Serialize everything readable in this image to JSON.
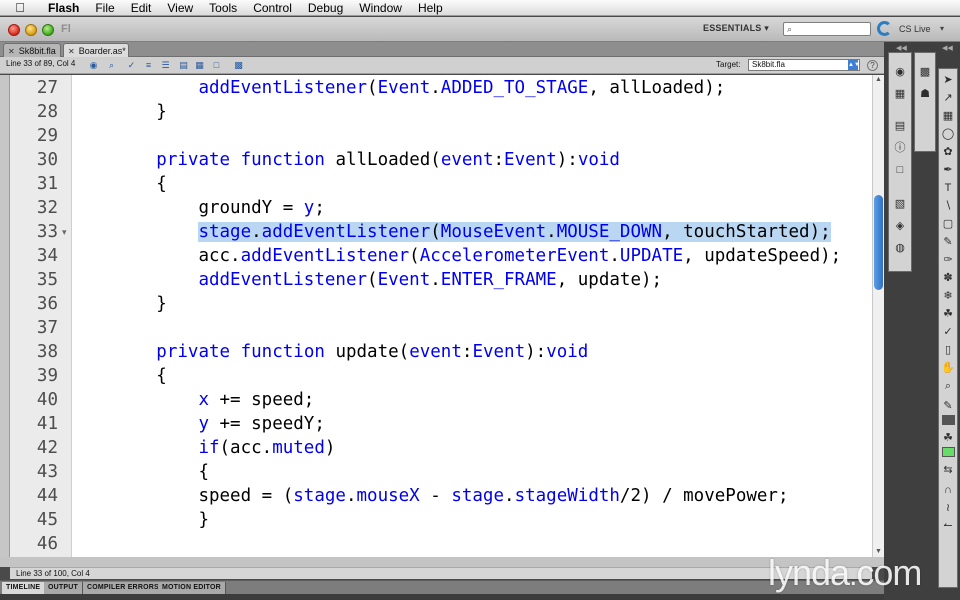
{
  "menubar": {
    "app_name": "Flash",
    "menus": [
      "File",
      "Edit",
      "View",
      "Tools",
      "Control",
      "Debug",
      "Window",
      "Help"
    ]
  },
  "appbar": {
    "workspace": "ESSENTIALS ▾",
    "search_placeholder": "⌕",
    "cs_live": "CS Live",
    "cs_live_caret": "▾"
  },
  "tabs": [
    {
      "label": "Sk8bit.fla",
      "active": false
    },
    {
      "label": "Boarder.as*",
      "active": true
    }
  ],
  "script_toolbar": {
    "line_info": "Line 33 of 89, Col 4",
    "target_label": "Target:",
    "target_value": "Sk8bit.fla"
  },
  "editor": {
    "fold_marker": "▾",
    "lines": [
      {
        "num": "27",
        "indent": "            ",
        "tokens": [
          {
            "t": "addEventListener",
            "k": "kw"
          },
          {
            "t": "(",
            "k": ""
          },
          {
            "t": "Event",
            "k": "kw"
          },
          {
            "t": ".",
            "k": ""
          },
          {
            "t": "ADDED_TO_STAGE",
            "k": "kw"
          },
          {
            "t": ", allLoaded);",
            "k": ""
          }
        ]
      },
      {
        "num": "28",
        "indent": "        ",
        "tokens": [
          {
            "t": "}",
            "k": ""
          }
        ]
      },
      {
        "num": "29",
        "indent": "",
        "tokens": []
      },
      {
        "num": "30",
        "indent": "        ",
        "tokens": [
          {
            "t": "private",
            "k": "kw"
          },
          {
            "t": " ",
            "k": ""
          },
          {
            "t": "function",
            "k": "kw"
          },
          {
            "t": " allLoaded(",
            "k": ""
          },
          {
            "t": "event",
            "k": "kw"
          },
          {
            "t": ":",
            "k": ""
          },
          {
            "t": "Event",
            "k": "kw"
          },
          {
            "t": "):",
            "k": ""
          },
          {
            "t": "void",
            "k": "kw"
          }
        ]
      },
      {
        "num": "31",
        "indent": "        ",
        "tokens": [
          {
            "t": "{",
            "k": ""
          }
        ]
      },
      {
        "num": "32",
        "indent": "            ",
        "tokens": [
          {
            "t": "groundY = ",
            "k": ""
          },
          {
            "t": "y",
            "k": "kw"
          },
          {
            "t": ";",
            "k": ""
          }
        ]
      },
      {
        "num": "33",
        "indent": "            ",
        "highlight": true,
        "tokens": [
          {
            "t": "stage",
            "k": "kw"
          },
          {
            "t": ".",
            "k": ""
          },
          {
            "t": "addEventListener",
            "k": "kw"
          },
          {
            "t": "(",
            "k": ""
          },
          {
            "t": "MouseEvent",
            "k": "kw"
          },
          {
            "t": ".",
            "k": ""
          },
          {
            "t": "MOUSE_DOWN",
            "k": "kw"
          },
          {
            "t": ", touchStarted);",
            "k": ""
          }
        ]
      },
      {
        "num": "34",
        "indent": "            ",
        "tokens": [
          {
            "t": "acc.",
            "k": ""
          },
          {
            "t": "addEventListener",
            "k": "kw"
          },
          {
            "t": "(",
            "k": ""
          },
          {
            "t": "AccelerometerEvent",
            "k": "kw"
          },
          {
            "t": ".",
            "k": ""
          },
          {
            "t": "UPDATE",
            "k": "kw"
          },
          {
            "t": ", updateSpeed);",
            "k": ""
          }
        ]
      },
      {
        "num": "35",
        "indent": "            ",
        "tokens": [
          {
            "t": "addEventListener",
            "k": "kw"
          },
          {
            "t": "(",
            "k": ""
          },
          {
            "t": "Event",
            "k": "kw"
          },
          {
            "t": ".",
            "k": ""
          },
          {
            "t": "ENTER_FRAME",
            "k": "kw"
          },
          {
            "t": ", update);",
            "k": ""
          }
        ]
      },
      {
        "num": "36",
        "indent": "        ",
        "tokens": [
          {
            "t": "}",
            "k": ""
          }
        ]
      },
      {
        "num": "37",
        "indent": "",
        "tokens": []
      },
      {
        "num": "38",
        "indent": "        ",
        "tokens": [
          {
            "t": "private",
            "k": "kw"
          },
          {
            "t": " ",
            "k": ""
          },
          {
            "t": "function",
            "k": "kw"
          },
          {
            "t": " update(",
            "k": ""
          },
          {
            "t": "event",
            "k": "kw"
          },
          {
            "t": ":",
            "k": ""
          },
          {
            "t": "Event",
            "k": "kw"
          },
          {
            "t": "):",
            "k": ""
          },
          {
            "t": "void",
            "k": "kw"
          }
        ]
      },
      {
        "num": "39",
        "indent": "        ",
        "tokens": [
          {
            "t": "{",
            "k": ""
          }
        ]
      },
      {
        "num": "40",
        "indent": "            ",
        "tokens": [
          {
            "t": "x",
            "k": "kw"
          },
          {
            "t": " += speed;",
            "k": ""
          }
        ]
      },
      {
        "num": "41",
        "indent": "            ",
        "tokens": [
          {
            "t": "y",
            "k": "kw"
          },
          {
            "t": " += speedY;",
            "k": ""
          }
        ]
      },
      {
        "num": "42",
        "indent": "            ",
        "tokens": [
          {
            "t": "if",
            "k": "kw"
          },
          {
            "t": "(acc.",
            "k": ""
          },
          {
            "t": "muted",
            "k": "kw"
          },
          {
            "t": ")",
            "k": ""
          }
        ]
      },
      {
        "num": "43",
        "indent": "            ",
        "tokens": [
          {
            "t": "{",
            "k": ""
          }
        ]
      },
      {
        "num": "44",
        "indent": "            ",
        "tokens": [
          {
            "t": "speed = (",
            "k": ""
          },
          {
            "t": "stage",
            "k": "kw"
          },
          {
            "t": ".",
            "k": ""
          },
          {
            "t": "mouseX",
            "k": "kw"
          },
          {
            "t": " - ",
            "k": ""
          },
          {
            "t": "stage",
            "k": "kw"
          },
          {
            "t": ".",
            "k": ""
          },
          {
            "t": "stageWidth",
            "k": "kw"
          },
          {
            "t": "/2) / movePower;",
            "k": ""
          }
        ]
      },
      {
        "num": "45",
        "indent": "            ",
        "tokens": [
          {
            "t": "}",
            "k": ""
          }
        ]
      },
      {
        "num": "46",
        "indent": "",
        "tokens": []
      }
    ]
  },
  "status": {
    "line_info": "Line 33 of 100, Col 4"
  },
  "panel_tabs": [
    "TIMELINE",
    "OUTPUT",
    "COMPILER ERRORS",
    "MOTION EDITOR"
  ],
  "colors": {
    "keyword": "#0000ee",
    "selection": "#b9d7f3",
    "fill_swatch": "#66dd66",
    "stroke_swatch": "#555555"
  },
  "watermark": {
    "text": "lynda",
    "dot": ".",
    "suffix": "com"
  }
}
